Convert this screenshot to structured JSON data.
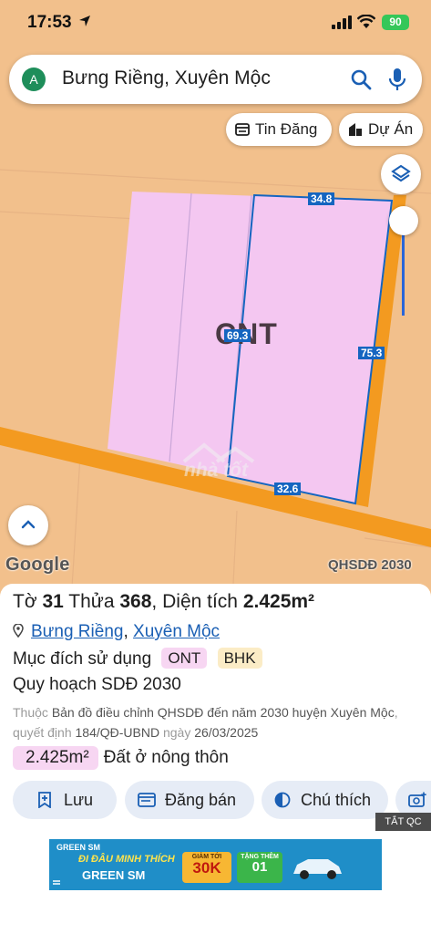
{
  "status_bar": {
    "time": "17:53",
    "battery": "90"
  },
  "search": {
    "avatar_letter": "A",
    "query": "Bưng Riềng, Xuyên Mộc"
  },
  "chips": {
    "listings": "Tin Đăng",
    "projects": "Dự Án"
  },
  "map": {
    "zone_code": "CNT",
    "dimensions": {
      "top": "34.8",
      "left": "69.3",
      "right": "75.3",
      "bottom": "32.6"
    },
    "watermark": "nhà tốt",
    "attribution": "Google",
    "layer": "QHSDĐ 2030",
    "colors": {
      "background": "#f2c08c",
      "parcel": "#f4c7f1",
      "road": "#f39a20",
      "boundary": "#1565c0"
    }
  },
  "parcel": {
    "sheet_label": "Tờ",
    "sheet_no": "31",
    "lot_label": "Thửa",
    "lot_no": "368",
    "area_label": "Diện tích",
    "area": "2.425m²",
    "ward": "Bưng Riềng",
    "district": "Xuyên Mộc",
    "purpose_label": "Mục đích sử dụng",
    "purpose_tags": [
      "ONT",
      "BHK"
    ],
    "plan_label": "Quy hoạch SDĐ 2030",
    "source_prefix": "Thuộc",
    "source_doc": "Bản đồ điều chỉnh QHSDĐ đến năm 2030 huyện Xuyên Mộc",
    "decision_label": "quyết định",
    "decision_no": "184/QĐ-UBND",
    "date_label": "ngày",
    "date": "26/03/2025",
    "area_badge": "2.425m²",
    "land_type": "Đất ở nông thôn"
  },
  "actions": {
    "save": "Lưu",
    "post": "Đăng bán",
    "legend": "Chú thích"
  },
  "ad": {
    "close_label": "TẮT QC",
    "brand": "GREEN SM",
    "slogan": "ĐI ĐÂU MINH THÍCH",
    "promo_top": "GIẢM TỚI",
    "promo_value": "30K",
    "promo2_top": "TẶNG THÊM",
    "promo2_value": "01"
  }
}
